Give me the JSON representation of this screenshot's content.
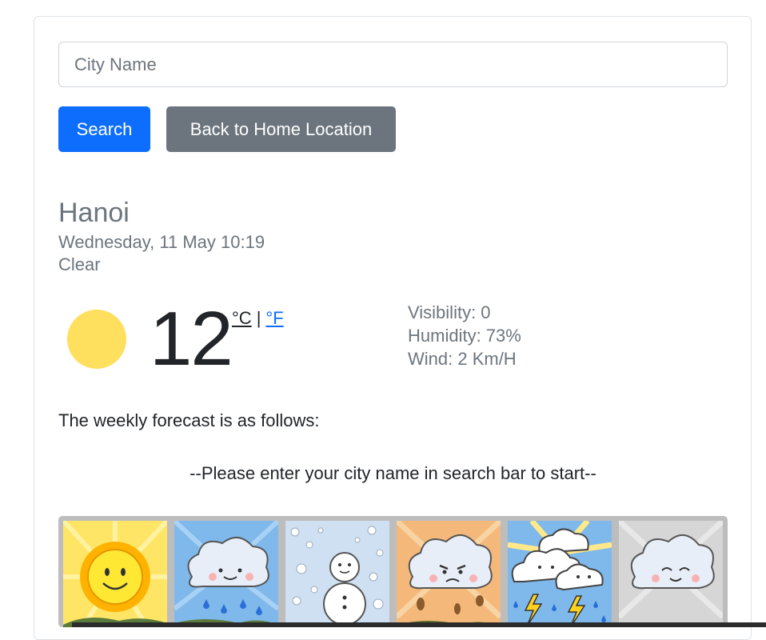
{
  "search": {
    "placeholder": "City Name",
    "search_label": "Search",
    "home_label": "Back to Home Location"
  },
  "current": {
    "city": "Hanoi",
    "datetime": "Wednesday, 11 May 10:19",
    "condition": "Clear",
    "temperature": "12",
    "unit_c": "°C",
    "unit_sep": "|",
    "unit_f": "°F",
    "visibility": "Visibility: 0",
    "humidity": "Humidity: 73%",
    "wind": "Wind: 2 Km/H"
  },
  "forecast": {
    "title": "The weekly forecast is as follows:",
    "message": "--Please enter your city name in search bar to start--"
  },
  "weather_tiles": [
    "sunny",
    "rain",
    "snow",
    "wind",
    "thunderstorm",
    "cloudy"
  ],
  "colors": {
    "primary": "#0d6efd",
    "secondary": "#6c757d",
    "sun": "#ffdf5e"
  }
}
